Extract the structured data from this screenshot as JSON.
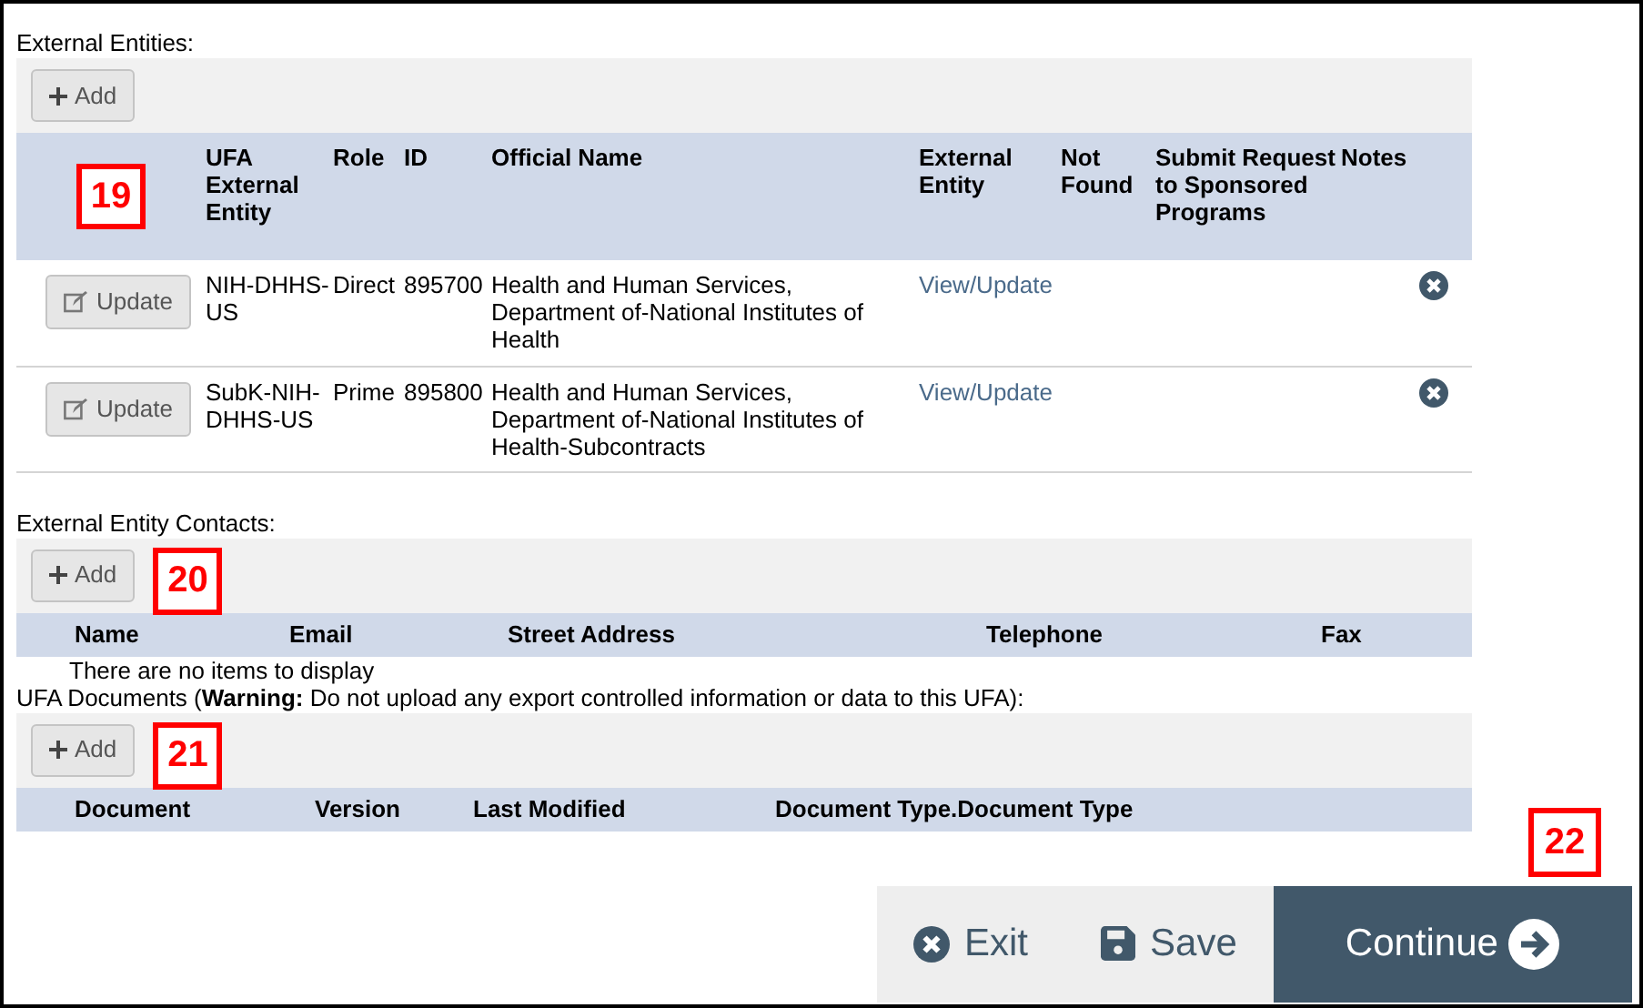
{
  "external_entities": {
    "label": "External Entities:",
    "add_button": "Add",
    "callout": "19",
    "columns": [
      "UFA External Entity",
      "Role",
      "ID",
      "Official Name",
      "External Entity",
      "Not Found",
      "Submit Request to Sponsored Programs",
      "Notes"
    ],
    "rows": [
      {
        "update_button": "Update",
        "entity": "NIH-DHHS-US",
        "role": "Direct",
        "id": "895700",
        "official_name": "Health and Human Services, Department of-National Institutes of Health",
        "link": "View/Update"
      },
      {
        "update_button": "Update",
        "entity": "SubK-NIH-DHHS-US",
        "role": "Prime",
        "id": "895800",
        "official_name": "Health and Human Services, Department of-National Institutes of Health-Subcontracts",
        "link": "View/Update"
      }
    ]
  },
  "contacts": {
    "label": "External Entity Contacts:",
    "add_button": "Add",
    "callout": "20",
    "columns": [
      "Name",
      "Email",
      "Street Address",
      "Telephone",
      "Fax"
    ],
    "empty_message": "There are no items to display"
  },
  "documents": {
    "label": "UFA Documents (**Warning:** Do not upload any export controlled information or data to this UFA):",
    "add_button": "Add",
    "callout": "21",
    "columns": [
      "Document",
      "Version",
      "Last Modified",
      "Document Type.Document Type"
    ]
  },
  "footer": {
    "callout": "22",
    "buttons": [
      {
        "kind": "exit",
        "label": "Exit"
      },
      {
        "kind": "save",
        "label": "Save"
      },
      {
        "kind": "continue",
        "label": "Continue"
      }
    ]
  }
}
